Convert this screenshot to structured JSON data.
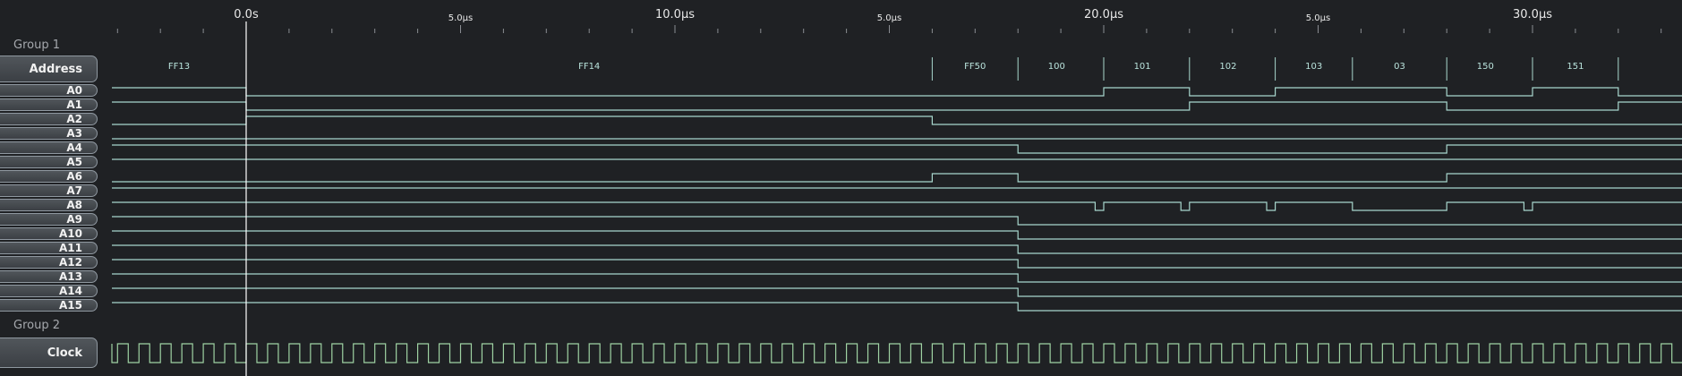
{
  "ruler": {
    "major": [
      {
        "t": 0,
        "label": "0.0s"
      },
      {
        "t": 10,
        "label": "10.0µs"
      },
      {
        "t": 20,
        "label": "20.0µs"
      },
      {
        "t": 30,
        "label": "30.0µs"
      }
    ],
    "minor": [
      {
        "t": 5,
        "label": "5.0µs"
      },
      {
        "t": 15,
        "label": "5.0µs"
      },
      {
        "t": 25,
        "label": "5.0µs"
      }
    ]
  },
  "cursor_time": 0,
  "groups": [
    {
      "label": "Group 1"
    },
    {
      "label": "Group 2"
    }
  ],
  "address": {
    "label": "Address",
    "segments": [
      {
        "start": -3.15,
        "end": 0,
        "value": "FF13"
      },
      {
        "start": 0,
        "end": 16,
        "value": "FF14"
      },
      {
        "start": 16,
        "end": 18,
        "value": "FF50"
      },
      {
        "start": 18,
        "end": 19.8,
        "value": "100"
      },
      {
        "start": 20,
        "end": 21.8,
        "value": "101"
      },
      {
        "start": 22,
        "end": 23.8,
        "value": "102"
      },
      {
        "start": 24,
        "end": 25.8,
        "value": "103"
      },
      {
        "start": 25.8,
        "end": 28,
        "value": "03"
      },
      {
        "start": 28,
        "end": 29.8,
        "value": "150"
      },
      {
        "start": 30,
        "end": 32,
        "value": "151"
      },
      {
        "start": 32,
        "end": 33.8,
        "value": ""
      }
    ]
  },
  "channels": [
    {
      "name": "A0",
      "init": 1,
      "edges": [
        0,
        20,
        22,
        24,
        28,
        30,
        32
      ]
    },
    {
      "name": "A1",
      "init": 1,
      "edges": [
        0,
        22,
        28,
        32
      ]
    },
    {
      "name": "A2",
      "init": 0,
      "edges": [
        0,
        16
      ]
    },
    {
      "name": "A3",
      "init": 0,
      "edges": []
    },
    {
      "name": "A4",
      "init": 1,
      "edges": [
        18,
        28
      ]
    },
    {
      "name": "A5",
      "init": 1,
      "edges": []
    },
    {
      "name": "A6",
      "init": 0,
      "edges": [
        16,
        18,
        28
      ]
    },
    {
      "name": "A7",
      "init": 1,
      "edges": []
    },
    {
      "name": "A8",
      "init": 1,
      "edges": [
        19.8,
        20,
        21.8,
        22,
        23.8,
        24,
        25.8,
        28,
        29.8,
        30
      ]
    },
    {
      "name": "A9",
      "init": 1,
      "edges": [
        18
      ]
    },
    {
      "name": "A10",
      "init": 1,
      "edges": [
        18
      ]
    },
    {
      "name": "A11",
      "init": 1,
      "edges": [
        18
      ]
    },
    {
      "name": "A12",
      "init": 1,
      "edges": [
        18
      ]
    },
    {
      "name": "A13",
      "init": 1,
      "edges": [
        18
      ]
    },
    {
      "name": "A14",
      "init": 1,
      "edges": [
        18
      ]
    },
    {
      "name": "A15",
      "init": 1,
      "edges": [
        18
      ]
    }
  ],
  "clock": {
    "label": "Clock",
    "period_us": 0.5,
    "phase_us": -0.25
  },
  "colors": {
    "background": "#1f2124",
    "trace": "#a8d7cd",
    "clock": "#9fd3a3",
    "cursor": "#ffffff",
    "tick": "#8a8d92"
  }
}
